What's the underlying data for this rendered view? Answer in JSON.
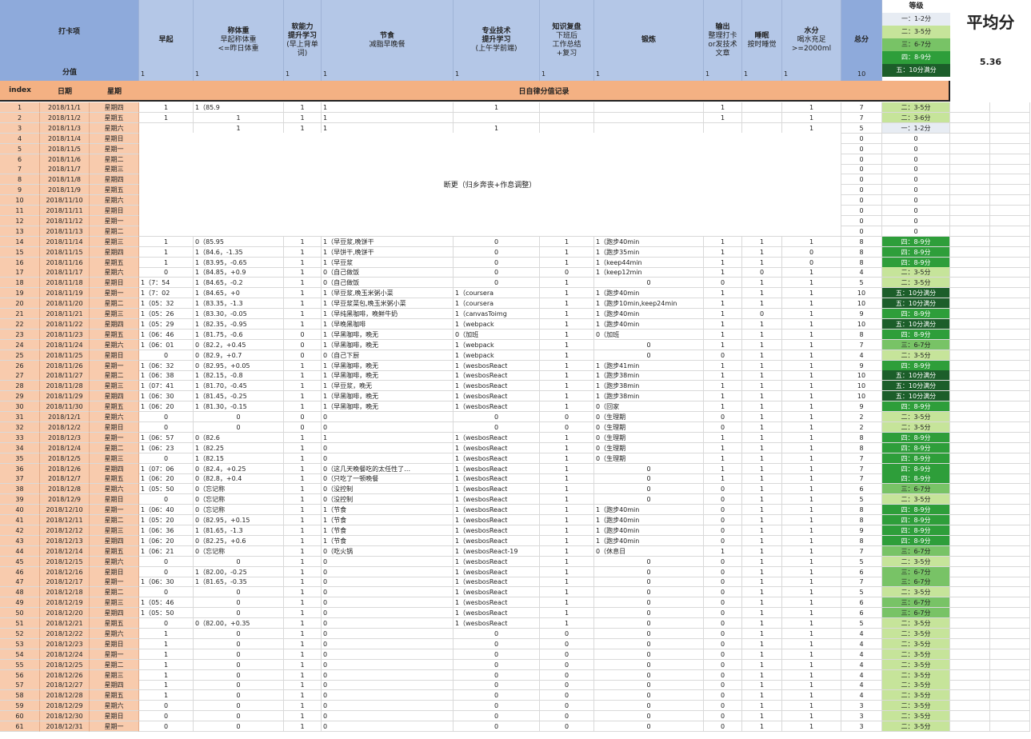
{
  "header": {
    "label_title": "打卡项",
    "label_score": "分值",
    "cols": [
      {
        "t": "早起",
        "s": ""
      },
      {
        "t": "称体重",
        "s": "早起称体重\n<=昨日体重"
      },
      {
        "t": "软能力\n提升学习",
        "s": "(早上背单词)"
      },
      {
        "t": "节食",
        "s": "减脂早晚餐"
      },
      {
        "t": "专业技术\n提升学习",
        "s": "(上午学前端)"
      },
      {
        "t": "知识复盘",
        "s": "下班后\n工作总结\n+复习"
      },
      {
        "t": "锻炼",
        "s": ""
      },
      {
        "t": "输出",
        "s": "整理打卡\nor发技术\n文章"
      },
      {
        "t": "睡眠",
        "s": "按时睡觉"
      },
      {
        "t": "水分",
        "s": "喝水充足\n>=2000ml"
      },
      {
        "t": "总分",
        "s": ""
      }
    ],
    "scores": [
      "1",
      "1",
      "1",
      "1",
      "1",
      "1",
      "1",
      "1",
      "1",
      "1",
      "10"
    ]
  },
  "level": {
    "title": "等级",
    "items": [
      {
        "label": "一：1-2分",
        "color": "#e7ecf3"
      },
      {
        "label": "二：3-5分",
        "color": "#c6e49a"
      },
      {
        "label": "三：6-7分",
        "color": "#78c366"
      },
      {
        "label": "四：8-9分",
        "color": "#2e9e3a"
      },
      {
        "label": "五：10分满分",
        "color": "#1c5e2a"
      }
    ]
  },
  "avg": {
    "title": "平均分",
    "value": "5.36"
  },
  "sub_head": {
    "index": "index",
    "date": "日期",
    "week": "星期",
    "record": "日自律分值记录"
  },
  "gap_note": "断更（归乡奔丧+作息调整）",
  "rows": [
    [
      "1",
      "2018/11/1",
      "星期四",
      "1",
      "1（85.9",
      "1",
      "1",
      "1",
      "",
      "",
      "1",
      "",
      "1",
      "7",
      "二：3-5分"
    ],
    [
      "2",
      "2018/11/2",
      "星期五",
      "1",
      "1",
      "1",
      "1",
      "",
      "",
      "",
      "1",
      "",
      "1",
      "7",
      "二：3-6分"
    ],
    [
      "3",
      "2018/11/3",
      "星期六",
      "",
      "1",
      "1",
      "1",
      "1",
      "",
      "",
      "",
      "",
      "1",
      "5",
      "一：1-2分"
    ],
    [
      "4",
      "2018/11/4",
      "星期日",
      "",
      "",
      "",
      "",
      "",
      "",
      "",
      "",
      "",
      "",
      "0",
      "0"
    ],
    [
      "5",
      "2018/11/5",
      "星期一",
      "",
      "",
      "",
      "",
      "",
      "",
      "",
      "",
      "",
      "",
      "0",
      "0"
    ],
    [
      "6",
      "2018/11/6",
      "星期二",
      "",
      "",
      "",
      "",
      "",
      "",
      "",
      "",
      "",
      "",
      "0",
      "0"
    ],
    [
      "7",
      "2018/11/7",
      "星期三",
      "",
      "",
      "",
      "",
      "",
      "",
      "",
      "",
      "",
      "",
      "0",
      "0"
    ],
    [
      "8",
      "2018/11/8",
      "星期四",
      "",
      "",
      "",
      "",
      "",
      "",
      "",
      "",
      "",
      "",
      "0",
      "0"
    ],
    [
      "9",
      "2018/11/9",
      "星期五",
      "",
      "",
      "",
      "",
      "",
      "",
      "",
      "",
      "",
      "",
      "0",
      "0"
    ],
    [
      "10",
      "2018/11/10",
      "星期六",
      "",
      "",
      "",
      "",
      "",
      "",
      "",
      "",
      "",
      "",
      "0",
      "0"
    ],
    [
      "11",
      "2018/11/11",
      "星期日",
      "",
      "",
      "",
      "",
      "",
      "",
      "",
      "",
      "",
      "",
      "0",
      "0"
    ],
    [
      "12",
      "2018/11/12",
      "星期一",
      "",
      "",
      "",
      "",
      "",
      "",
      "",
      "",
      "",
      "",
      "0",
      "0"
    ],
    [
      "13",
      "2018/11/13",
      "星期二",
      "",
      "",
      "",
      "",
      "",
      "",
      "",
      "",
      "",
      "",
      "0",
      "0"
    ],
    [
      "14",
      "2018/11/14",
      "星期三",
      "1",
      "0（85.95",
      "1",
      "1（早豆浆,晚饼干",
      "0",
      "1",
      "1（跑步40min",
      "1",
      "1",
      "1",
      "8",
      "四：8-9分"
    ],
    [
      "15",
      "2018/11/15",
      "星期四",
      "1",
      "1（84.6，-1.35",
      "1",
      "1（早饼干,晚饼干",
      "0",
      "1",
      "1（跑步35min",
      "1",
      "1",
      "0",
      "8",
      "四：8-9分"
    ],
    [
      "16",
      "2018/11/16",
      "星期五",
      "1",
      "1（83.95，-0.65",
      "1",
      "1（早豆浆",
      "0",
      "1",
      "1（keep44min",
      "1",
      "1",
      "0",
      "8",
      "四：8-9分"
    ],
    [
      "17",
      "2018/11/17",
      "星期六",
      "0",
      "1（84.85，+0.9",
      "1",
      "0（自己做饭",
      "0",
      "0",
      "1（keep12min",
      "1",
      "0",
      "1",
      "4",
      "二：3-5分"
    ],
    [
      "18",
      "2018/11/18",
      "星期日",
      "1（7：54",
      "1（84.65，-0.2",
      "1",
      "0（自己做饭",
      "0",
      "1",
      "0",
      "0",
      "1",
      "1",
      "5",
      "二：3-5分"
    ],
    [
      "19",
      "2018/11/19",
      "星期一",
      "1（7：02",
      "1（84.65，+0",
      "1",
      "1（早豆浆,晚玉米粥小菜",
      "1（coursera",
      "1",
      "1（跑步40min",
      "1",
      "1",
      "1",
      "10",
      "五：10分满分"
    ],
    [
      "20",
      "2018/11/20",
      "星期二",
      "1（05：32",
      "1（83.35，-1.3",
      "1",
      "1（早豆浆菜包,晚玉米粥小菜",
      "1（coursera",
      "1",
      "1（跑步10min,keep24min",
      "1",
      "1",
      "1",
      "10",
      "五：10分满分"
    ],
    [
      "21",
      "2018/11/21",
      "星期三",
      "1（05：26",
      "1（83.30，-0.05",
      "1",
      "1（早纯黑咖啡，晚鲜牛奶",
      "1（canvasToimg",
      "1",
      "1（跑步40min",
      "1",
      "0",
      "1",
      "9",
      "四：8-9分"
    ],
    [
      "22",
      "2018/11/22",
      "星期四",
      "1（05：29",
      "1（82.35，-0.95",
      "1",
      "1（早晚黑咖啡",
      "1（webpack",
      "1",
      "1（跑步40min",
      "1",
      "1",
      "1",
      "10",
      "五：10分满分"
    ],
    [
      "23",
      "2018/11/23",
      "星期五",
      "1（06：46",
      "1（81.75，-0.6",
      "0",
      "1（早黑咖啡，晚无",
      "0（加班",
      "1",
      "0（加班",
      "1",
      "1",
      "1",
      "8",
      "四：8-9分"
    ],
    [
      "24",
      "2018/11/24",
      "星期六",
      "1（06：01",
      "0（82.2，+0.45",
      "0",
      "1（早黑咖啡，晚无",
      "1（webpack",
      "1",
      "0",
      "1",
      "1",
      "1",
      "7",
      "三：6-7分"
    ],
    [
      "25",
      "2018/11/25",
      "星期日",
      "0",
      "0（82.9，+0.7",
      "0",
      "0（自己下厨",
      "1（webpack",
      "1",
      "0",
      "0",
      "1",
      "1",
      "4",
      "二：3-5分"
    ],
    [
      "26",
      "2018/11/26",
      "星期一",
      "1（06：32",
      "0（82.95，+0.05",
      "1",
      "1（早黑咖啡，晚无",
      "1（wesbosReact",
      "1",
      "1（跑步41min",
      "1",
      "1",
      "1",
      "9",
      "四：8-9分"
    ],
    [
      "27",
      "2018/11/27",
      "星期二",
      "1（06：38",
      "1（82.15，-0.8",
      "1",
      "1（早黑咖啡，晚无",
      "1（wesbosReact",
      "1",
      "1（跑步38min",
      "1",
      "1",
      "1",
      "10",
      "五：10分满分"
    ],
    [
      "28",
      "2018/11/28",
      "星期三",
      "1（07：41",
      "1（81.70，-0.45",
      "1",
      "1（早豆浆，晚无",
      "1（wesbosReact",
      "1",
      "1（跑步38min",
      "1",
      "1",
      "1",
      "10",
      "五：10分满分"
    ],
    [
      "29",
      "2018/11/29",
      "星期四",
      "1（06：30",
      "1（81.45，-0.25",
      "1",
      "1（早黑咖啡，晚无",
      "1（wesbosReact",
      "1",
      "1（跑步38min",
      "1",
      "1",
      "1",
      "10",
      "五：10分满分"
    ],
    [
      "30",
      "2018/11/30",
      "星期五",
      "1（06：20",
      "1（81.30，-0.15",
      "1",
      "1（早黑咖啡，晚无",
      "1（wesbosReact",
      "1",
      "0（回家",
      "1",
      "1",
      "1",
      "9",
      "四：8-9分"
    ],
    [
      "31",
      "2018/12/1",
      "星期六",
      "0",
      "0",
      "0",
      "0",
      "0",
      "0",
      "0（生理期",
      "0",
      "1",
      "1",
      "2",
      "二：3-5分"
    ],
    [
      "32",
      "2018/12/2",
      "星期日",
      "0",
      "0",
      "0",
      "0",
      "0",
      "0",
      "0（生理期",
      "0",
      "1",
      "1",
      "2",
      "二：3-5分"
    ],
    [
      "33",
      "2018/12/3",
      "星期一",
      "1（06：57",
      "0（82.6",
      "1",
      "1",
      "1（wesbosReact",
      "1",
      "0（生理期",
      "1",
      "1",
      "1",
      "8",
      "四：8-9分"
    ],
    [
      "34",
      "2018/12/4",
      "星期二",
      "1（06：23",
      "1（82.25",
      "1",
      "0",
      "1（wesbosReact",
      "1",
      "0（生理期",
      "1",
      "1",
      "1",
      "8",
      "四：8-9分"
    ],
    [
      "35",
      "2018/12/5",
      "星期三",
      "0",
      "1（82.15",
      "1",
      "0",
      "1（wesbosReact",
      "1",
      "0（生理期",
      "1",
      "1",
      "1",
      "7",
      "四：8-9分"
    ],
    [
      "36",
      "2018/12/6",
      "星期四",
      "1（07：06",
      "0（82.4，+0.25",
      "1",
      "0（这几天晚餐吃的太任性了…",
      "1（wesbosReact",
      "1",
      "0",
      "1",
      "1",
      "1",
      "7",
      "四：8-9分"
    ],
    [
      "37",
      "2018/12/7",
      "星期五",
      "1（06：20",
      "0（82.8，+0.4",
      "1",
      "0（只吃了一顿晚餐",
      "1（wesbosReact",
      "1",
      "0",
      "1",
      "1",
      "1",
      "7",
      "四：8-9分"
    ],
    [
      "38",
      "2018/12/8",
      "星期六",
      "1（05：50",
      "0（忘记称",
      "1",
      "0（没控制",
      "1（wesbosReact",
      "1",
      "0",
      "0",
      "1",
      "1",
      "6",
      "三：6-7分"
    ],
    [
      "39",
      "2018/12/9",
      "星期日",
      "0",
      "0（忘记称",
      "1",
      "0（没控制",
      "1（wesbosReact",
      "1",
      "0",
      "0",
      "1",
      "1",
      "5",
      "二：3-5分"
    ],
    [
      "40",
      "2018/12/10",
      "星期一",
      "1（06：40",
      "0（忘记称",
      "1",
      "1（节食",
      "1（wesbosReact",
      "1",
      "1（跑步40min",
      "0",
      "1",
      "1",
      "8",
      "四：8-9分"
    ],
    [
      "41",
      "2018/12/11",
      "星期二",
      "1（05：20",
      "0（82.95，+0.15",
      "1",
      "1（节食",
      "1（wesbosReact",
      "1",
      "1（跑步40min",
      "0",
      "1",
      "1",
      "8",
      "四：8-9分"
    ],
    [
      "42",
      "2018/12/12",
      "星期三",
      "1（06：36",
      "1（81.65，-1.3",
      "1",
      "1（节食",
      "1（wesbosReact",
      "1",
      "1（跑步40min",
      "0",
      "1",
      "1",
      "9",
      "四：8-9分"
    ],
    [
      "43",
      "2018/12/13",
      "星期四",
      "1（06：20",
      "0（82.25，+0.6",
      "1",
      "1（节食",
      "1（wesbosReact",
      "1",
      "1（跑步40min",
      "0",
      "1",
      "1",
      "8",
      "四：8-9分"
    ],
    [
      "44",
      "2018/12/14",
      "星期五",
      "1（06：21",
      "0（忘记称",
      "1",
      "0（吃火锅",
      "1（wesbosReact-19",
      "1",
      "0（休息日",
      "1",
      "1",
      "1",
      "7",
      "三：6-7分"
    ],
    [
      "45",
      "2018/12/15",
      "星期六",
      "0",
      "0",
      "1",
      "0",
      "1（wesbosReact",
      "1",
      "0",
      "0",
      "1",
      "1",
      "5",
      "二：3-5分"
    ],
    [
      "46",
      "2018/12/16",
      "星期日",
      "0",
      "1（82.00，-0.25",
      "1",
      "0",
      "1（wesbosReact",
      "1",
      "0",
      "0",
      "1",
      "1",
      "6",
      "三：6-7分"
    ],
    [
      "47",
      "2018/12/17",
      "星期一",
      "1（06：30",
      "1（81.65，-0.35",
      "1",
      "0",
      "1（wesbosReact",
      "1",
      "0",
      "0",
      "1",
      "1",
      "7",
      "三：6-7分"
    ],
    [
      "48",
      "2018/12/18",
      "星期二",
      "0",
      "0",
      "1",
      "0",
      "1（wesbosReact",
      "1",
      "0",
      "0",
      "1",
      "1",
      "5",
      "二：3-5分"
    ],
    [
      "49",
      "2018/12/19",
      "星期三",
      "1（05：46",
      "0",
      "1",
      "0",
      "1（wesbosReact",
      "1",
      "0",
      "0",
      "1",
      "1",
      "6",
      "三：6-7分"
    ],
    [
      "50",
      "2018/12/20",
      "星期四",
      "1（05：50",
      "0",
      "1",
      "0",
      "1（wesbosReact",
      "1",
      "0",
      "0",
      "1",
      "1",
      "6",
      "三：6-7分"
    ],
    [
      "51",
      "2018/12/21",
      "星期五",
      "0",
      "0（82.00，+0.35",
      "1",
      "0",
      "1（wesbosReact",
      "1",
      "0",
      "0",
      "1",
      "1",
      "5",
      "二：3-5分"
    ],
    [
      "52",
      "2018/12/22",
      "星期六",
      "1",
      "0",
      "1",
      "0",
      "0",
      "0",
      "0",
      "0",
      "1",
      "1",
      "4",
      "二：3-5分"
    ],
    [
      "53",
      "2018/12/23",
      "星期日",
      "1",
      "0",
      "1",
      "0",
      "0",
      "0",
      "0",
      "0",
      "1",
      "1",
      "4",
      "二：3-5分"
    ],
    [
      "54",
      "2018/12/24",
      "星期一",
      "1",
      "0",
      "1",
      "0",
      "0",
      "0",
      "0",
      "0",
      "1",
      "1",
      "4",
      "二：3-5分"
    ],
    [
      "55",
      "2018/12/25",
      "星期二",
      "1",
      "0",
      "1",
      "0",
      "0",
      "0",
      "0",
      "0",
      "1",
      "1",
      "4",
      "二：3-5分"
    ],
    [
      "56",
      "2018/12/26",
      "星期三",
      "1",
      "0",
      "1",
      "0",
      "0",
      "0",
      "0",
      "0",
      "1",
      "1",
      "4",
      "二：3-5分"
    ],
    [
      "57",
      "2018/12/27",
      "星期四",
      "1",
      "0",
      "1",
      "0",
      "0",
      "0",
      "0",
      "0",
      "1",
      "1",
      "4",
      "二：3-5分"
    ],
    [
      "58",
      "2018/12/28",
      "星期五",
      "1",
      "0",
      "1",
      "0",
      "0",
      "0",
      "0",
      "0",
      "1",
      "1",
      "4",
      "二：3-5分"
    ],
    [
      "59",
      "2018/12/29",
      "星期六",
      "0",
      "0",
      "1",
      "0",
      "0",
      "0",
      "0",
      "0",
      "1",
      "1",
      "3",
      "二：3-5分"
    ],
    [
      "60",
      "2018/12/30",
      "星期日",
      "0",
      "0",
      "1",
      "0",
      "0",
      "0",
      "0",
      "0",
      "1",
      "1",
      "3",
      "二：3-5分"
    ],
    [
      "61",
      "2018/12/31",
      "星期一",
      "0",
      "0",
      "1",
      "0",
      "0",
      "0",
      "0",
      "0",
      "1",
      "1",
      "3",
      "二：3-5分"
    ]
  ]
}
